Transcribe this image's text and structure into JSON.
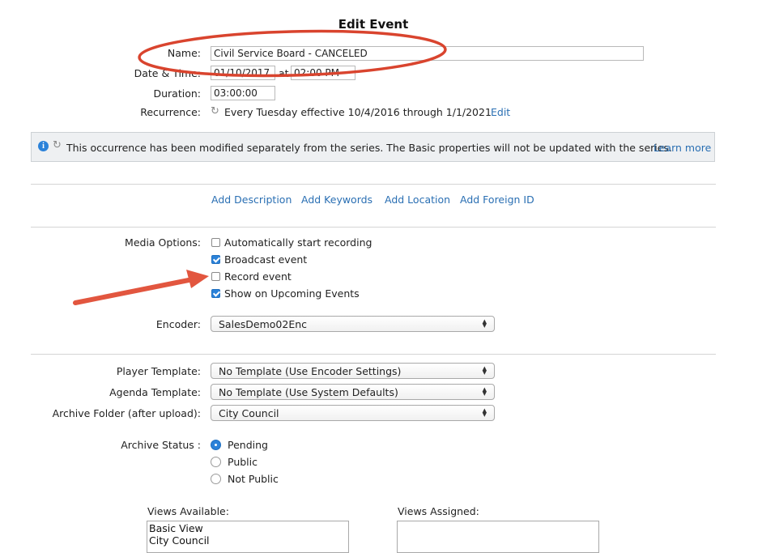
{
  "title": "Edit Event",
  "name": {
    "label": "Name:",
    "value": "Civil Service Board - CANCELED"
  },
  "datetime": {
    "label": "Date & Time:",
    "date": "01/10/2017",
    "at": "at",
    "time": "02:00 PM"
  },
  "duration": {
    "label": "Duration:",
    "value": "03:00:00"
  },
  "recurrence": {
    "label": "Recurrence:",
    "text": "Every Tuesday effective 10/4/2016 through 1/1/2021",
    "edit_link": "Edit"
  },
  "banner": {
    "text": "This occurrence has been modified separately from the series. The Basic properties will not be updated with the series.",
    "link": "Learn more"
  },
  "add_links": [
    "Add Description",
    "Add Keywords",
    "Add Location",
    "Add Foreign ID"
  ],
  "media": {
    "label": "Media Options:",
    "options": [
      {
        "label": "Automatically start recording",
        "checked": false
      },
      {
        "label": "Broadcast event",
        "checked": true
      },
      {
        "label": "Record event",
        "checked": false
      },
      {
        "label": "Show on Upcoming Events",
        "checked": true
      }
    ]
  },
  "encoder": {
    "label": "Encoder:",
    "value": "SalesDemo02Enc"
  },
  "player_template": {
    "label": "Player Template:",
    "value": "No Template (Use Encoder Settings)"
  },
  "agenda_template": {
    "label": "Agenda Template:",
    "value": "No Template (Use System Defaults)"
  },
  "archive_folder": {
    "label": "Archive Folder (after upload):",
    "value": "City Council"
  },
  "archive_status": {
    "label": "Archive Status :",
    "options": [
      {
        "label": "Pending",
        "selected": true
      },
      {
        "label": "Public",
        "selected": false
      },
      {
        "label": "Not Public",
        "selected": false
      }
    ]
  },
  "views_available": {
    "label": "Views Available:",
    "items": [
      "Basic View",
      "City Council"
    ]
  },
  "views_assigned": {
    "label": "Views Assigned:",
    "items": []
  },
  "colors": {
    "accent": "#2b82d9",
    "link": "#2a6fb3",
    "annotation": "#d9442e"
  }
}
